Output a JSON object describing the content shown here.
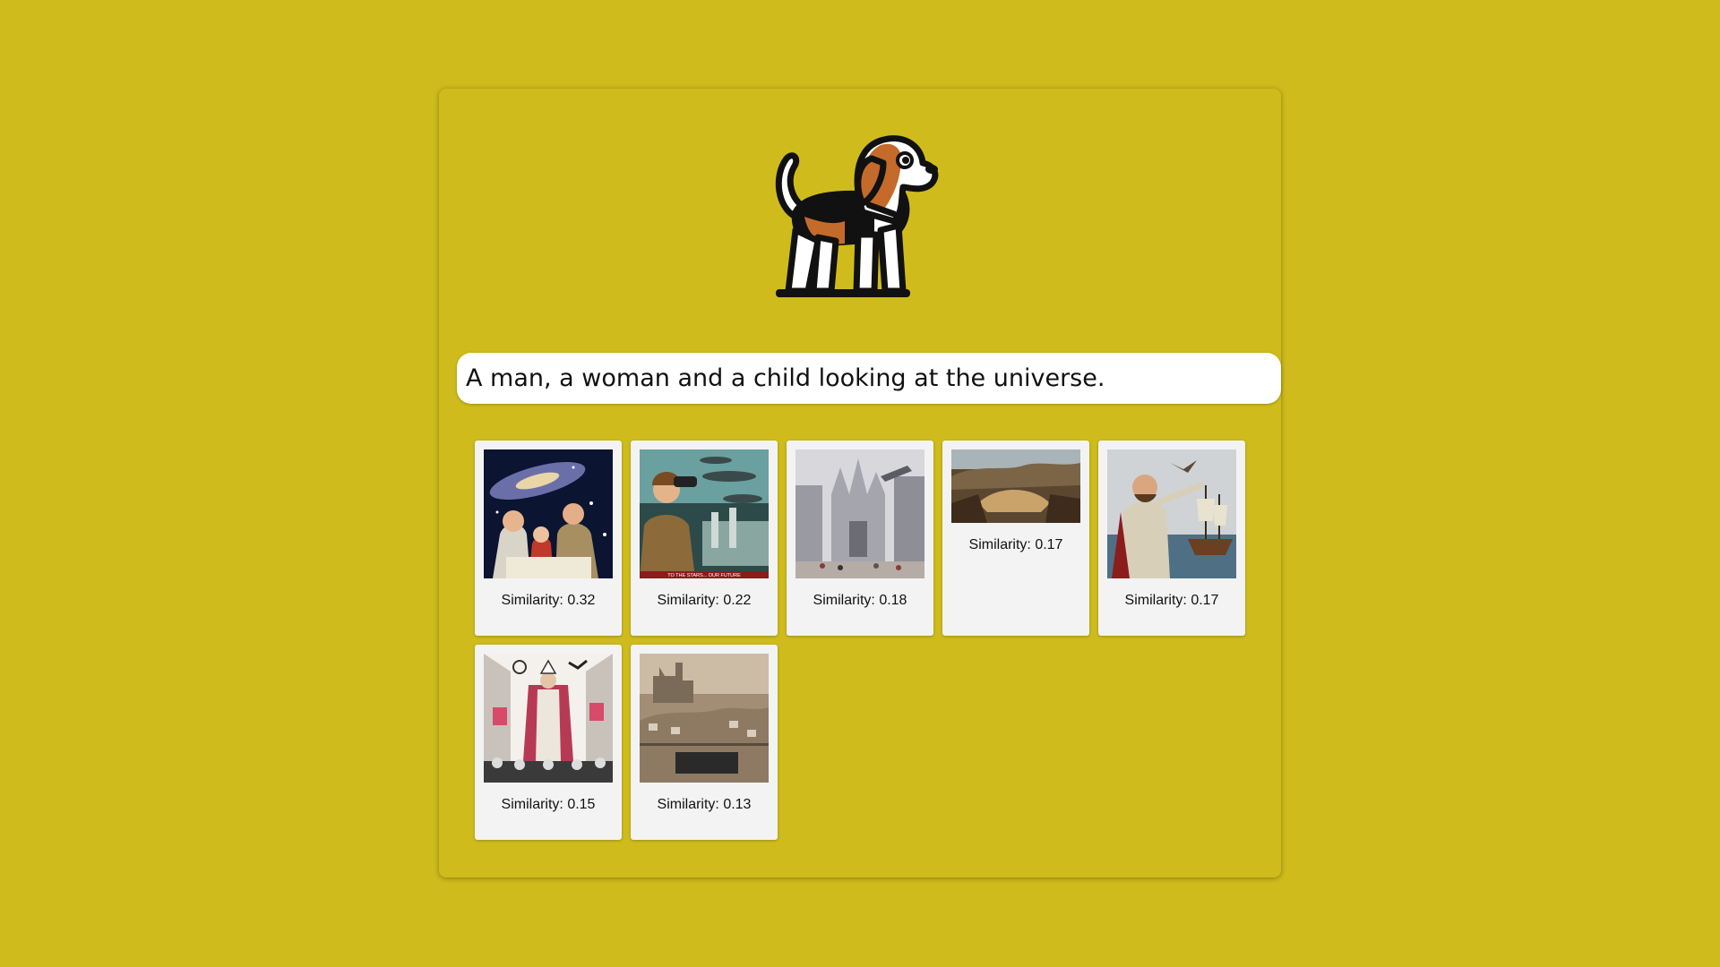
{
  "search": {
    "value": "A man, a woman and a child looking at the universe."
  },
  "logo": {
    "icon": "beagle-dog-icon"
  },
  "results": [
    {
      "caption": "Similarity: 0.32",
      "image": "retro-family-space-poster"
    },
    {
      "caption": "Similarity: 0.22",
      "image": "woman-binoculars-spaceships-poster",
      "banner": "TO THE STARS... OUR FUTURE"
    },
    {
      "caption": "Similarity: 0.18",
      "image": "gothic-city-airship"
    },
    {
      "caption": "Similarity: 0.17",
      "image": "aerial-valley-landscape"
    },
    {
      "caption": "Similarity: 0.17",
      "image": "commander-galleon-sea"
    },
    {
      "caption": "Similarity: 0.15",
      "image": "bishop-procession-street"
    },
    {
      "caption": "Similarity: 0.13",
      "image": "castle-army-formation"
    }
  ],
  "colors": {
    "background": "#cfbc1c",
    "card": "#f3f3f3"
  }
}
